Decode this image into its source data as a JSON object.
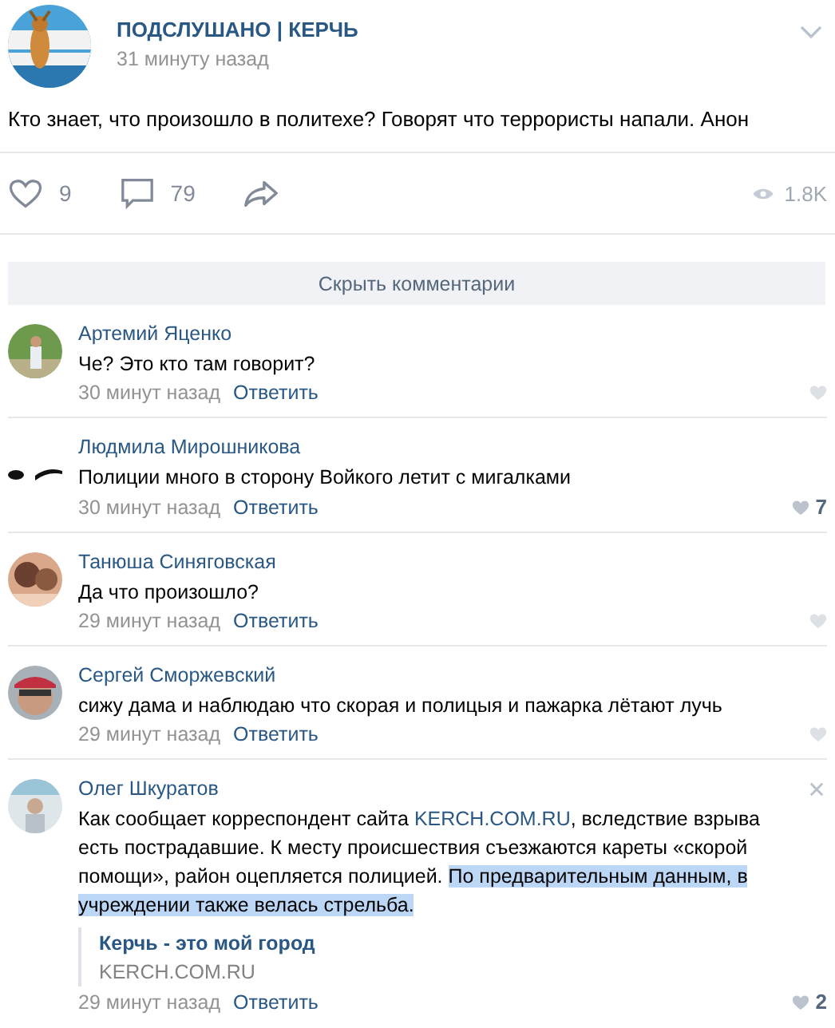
{
  "post": {
    "group": "ПОДСЛУШАНО | КЕРЧЬ",
    "time": "31 минуту назад",
    "text": "Кто знает, что произошло в политехе? Говорят что террористы напали. Анон",
    "likes": "9",
    "comments": "79",
    "views": "1.8K"
  },
  "hide_comments": "Скрыть комментарии",
  "comments": [
    {
      "author": "Артемий Яценко",
      "body": [
        {
          "kind": "text",
          "text": "Че? Это кто там говорит?"
        }
      ],
      "time": "30 минут назад",
      "reply": "Ответить",
      "close_button": false
    },
    {
      "author": "Людмила Мирошникова",
      "body": [
        {
          "kind": "text",
          "text": "Полиции много в сторону Войкого летит с мигалками"
        }
      ],
      "time": "30 минут назад",
      "reply": "Ответить",
      "likes": "7",
      "close_button": false
    },
    {
      "author": "Танюша Синяговская",
      "body": [
        {
          "kind": "text",
          "text": "Да что произошло?"
        }
      ],
      "time": "29 минут назад",
      "reply": "Ответить",
      "close_button": false
    },
    {
      "author": "Сергей Сморжевский",
      "body": [
        {
          "kind": "text",
          "text": "сижу дама и наблюдаю что скорая и полицыя и пажарка лётают лучь"
        }
      ],
      "time": "29 минут назад",
      "reply": "Ответить",
      "close_button": false
    },
    {
      "author": "Олег Шкуратов",
      "body": [
        {
          "kind": "text",
          "text": "Как сообщает корреспондент сайта "
        },
        {
          "kind": "link",
          "text": "KERCH.COM.RU"
        },
        {
          "kind": "text",
          "text": ", вследствие взрыва есть пострадавшие. К месту происшествия съезжаются кареты «скорой помощи», район оцепляется полицией. "
        },
        {
          "kind": "highlight",
          "text": "По предварительным данным, в учреждении также велась стрельба."
        }
      ],
      "attachment": {
        "title": "Керчь - это мой город",
        "domain": "KERCH.COM.RU"
      },
      "time": "29 минут назад",
      "reply": "Ответить",
      "likes": "2",
      "close_button": true
    }
  ]
}
